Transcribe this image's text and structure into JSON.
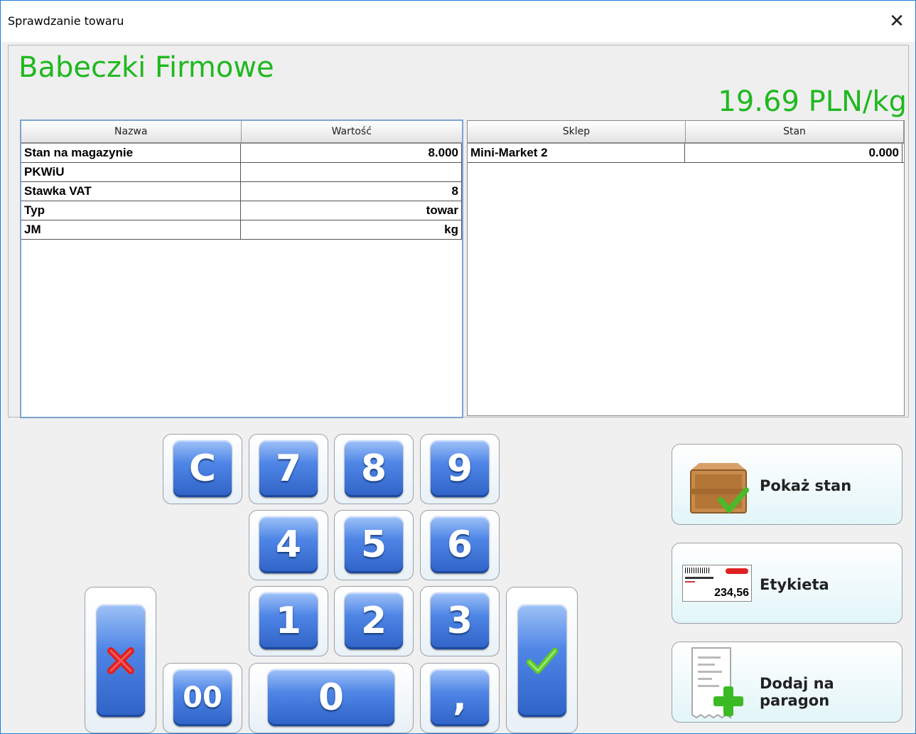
{
  "window": {
    "title": "Sprawdzanie towaru"
  },
  "product": {
    "name": "Babeczki Firmowe",
    "price": "19.69 PLN/kg"
  },
  "details_table": {
    "headers": [
      "Nazwa",
      "Wartość"
    ],
    "rows": [
      {
        "name": "Stan na magazynie",
        "value": "8.000"
      },
      {
        "name": "PKWiU",
        "value": ""
      },
      {
        "name": "Stawka VAT",
        "value": "8"
      },
      {
        "name": "Typ",
        "value": "towar"
      },
      {
        "name": "JM",
        "value": "kg"
      }
    ]
  },
  "stock_table": {
    "headers": [
      "Sklep",
      "Stan"
    ],
    "rows": [
      {
        "shop": "Mini-Market 2",
        "stock": "0.000"
      }
    ]
  },
  "keypad": {
    "clear": "C",
    "k7": "7",
    "k8": "8",
    "k9": "9",
    "k4": "4",
    "k5": "5",
    "k6": "6",
    "k1": "1",
    "k2": "2",
    "k3": "3",
    "k00": "00",
    "k0": "0",
    "comma": ","
  },
  "actions": {
    "show_stock": "Pokaż stan",
    "label": "Etykieta",
    "add_to_receipt": "Dodaj na paragon"
  },
  "label_icon": {
    "price": "234,56"
  },
  "colors": {
    "accent_green": "#1fb81f",
    "key_blue": "#3a6fd6",
    "cancel_red": "#e02020",
    "ok_green": "#5bc82a"
  }
}
